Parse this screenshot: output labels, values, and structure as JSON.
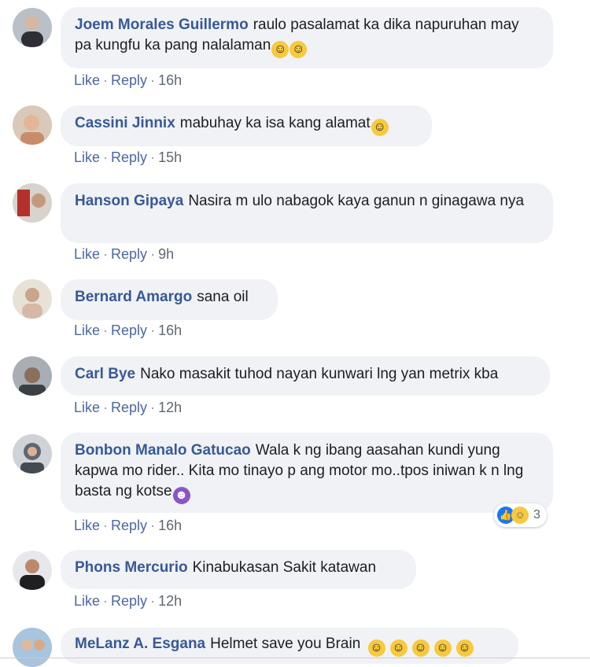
{
  "comments": [
    {
      "author": "Joem Morales Guillermo",
      "text": "raulo pasalamat ka dika napuruhan may pa kungfu ka pang nalalaman",
      "emojis": [
        "rolling-on-floor-laughing-emoji",
        "rolling-on-floor-laughing-emoji"
      ],
      "like": "Like",
      "reply": "Reply",
      "time": "16h"
    },
    {
      "author": "Cassini Jinnix",
      "text": "mabuhay ka isa kang alamat",
      "emojis": [
        "grinning-emoji"
      ],
      "like": "Like",
      "reply": "Reply",
      "time": "15h"
    },
    {
      "author": "Hanson Gipaya",
      "text": "Nasira m ulo nabagok kaya ganun n ginagawa nya",
      "like": "Like",
      "reply": "Reply",
      "time": "9h"
    },
    {
      "author": "Bernard Amargo",
      "text": "sana oil",
      "like": "Like",
      "reply": "Reply",
      "time": "16h"
    },
    {
      "author": "Carl Bye",
      "text": "Nako masakit tuhod nayan kunwari lng yan metrix kba",
      "like": "Like",
      "reply": "Reply",
      "time": "12h"
    },
    {
      "author": "Bonbon Manalo Gatucao",
      "text": "Wala k ng ibang aasahan kundi yung kapwa mo rider.. Kita mo tinayo p ang motor mo..tpos iniwan k n lng basta ng kotse",
      "emojis": [
        "angry-devil-emoji"
      ],
      "like": "Like",
      "reply": "Reply",
      "time": "16h",
      "reactions": {
        "count": "3",
        "icons": [
          "like-reaction-icon",
          "haha-reaction-icon"
        ]
      }
    },
    {
      "author": "Phons Mercurio",
      "text": "Kinabukasan Sakit katawan",
      "like": "Like",
      "reply": "Reply",
      "time": "12h"
    },
    {
      "author": "MeLanz A. Esgana",
      "text": "Helmet save you Brain",
      "emojis": [
        "rolling-on-floor-laughing-emoji",
        "rolling-on-floor-laughing-emoji",
        "rolling-on-floor-laughing-emoji",
        "rolling-on-floor-laughing-emoji",
        "rolling-on-floor-laughing-emoji"
      ]
    }
  ],
  "colors": {
    "author": "#385898",
    "bubble": "#f0f2f5",
    "action_link": "#4b67a1",
    "like_reaction": "#1877f2"
  }
}
